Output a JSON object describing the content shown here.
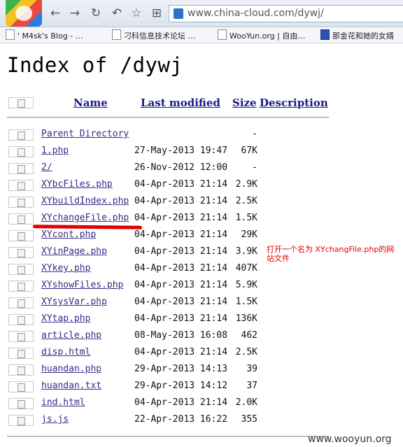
{
  "browser": {
    "address": "www.china-cloud.com/dywj/",
    "bookmarks": [
      "' M4sk's Blog - …",
      "刁科信息技术论坛 …",
      "WooYun.org | 自由…",
      "那金花和她的女婿"
    ]
  },
  "page": {
    "title": "Index of /dywj",
    "headers": {
      "name": "Name",
      "modified": "Last modified",
      "size": "Size",
      "description": "Description"
    },
    "rows": [
      {
        "name": "Parent Directory",
        "date": "",
        "size": "-"
      },
      {
        "name": "1.php",
        "date": "27-May-2013 19:47",
        "size": "67K"
      },
      {
        "name": "2/",
        "date": "26-Nov-2012 12:00",
        "size": "-"
      },
      {
        "name": "XYbcFiles.php",
        "date": "04-Apr-2013 21:14",
        "size": "2.9K"
      },
      {
        "name": "XYbuildIndex.php",
        "date": "04-Apr-2013 21:14",
        "size": "2.5K"
      },
      {
        "name": "XYchangeFile.php",
        "date": "04-Apr-2013 21:14",
        "size": "1.5K"
      },
      {
        "name": "XYcont.php",
        "date": "04-Apr-2013 21:14",
        "size": "29K"
      },
      {
        "name": "XYinPage.php",
        "date": "04-Apr-2013 21:14",
        "size": "3.9K"
      },
      {
        "name": "XYkey.php",
        "date": "04-Apr-2013 21:14",
        "size": "407K"
      },
      {
        "name": "XYshowFiles.php",
        "date": "04-Apr-2013 21:14",
        "size": "5.9K"
      },
      {
        "name": "XYsysVar.php",
        "date": "04-Apr-2013 21:14",
        "size": "1.5K"
      },
      {
        "name": "XYtap.php",
        "date": "04-Apr-2013 21:14",
        "size": "136K"
      },
      {
        "name": "article.php",
        "date": "08-May-2013 16:08",
        "size": "462"
      },
      {
        "name": "disp.html",
        "date": "04-Apr-2013 21:14",
        "size": "2.5K"
      },
      {
        "name": "huandan.php",
        "date": "29-Apr-2013 14:13",
        "size": "39"
      },
      {
        "name": "huandan.txt",
        "date": "29-Apr-2013 14:12",
        "size": "37"
      },
      {
        "name": "ind.html",
        "date": "04-Apr-2013 21:14",
        "size": "2.0K"
      },
      {
        "name": "js.js",
        "date": "22-Apr-2013 16:22",
        "size": "355"
      }
    ],
    "annotation": "打开一个名为 XYchangFile.php的网站文件",
    "watermark": "www.wooyun.org"
  }
}
